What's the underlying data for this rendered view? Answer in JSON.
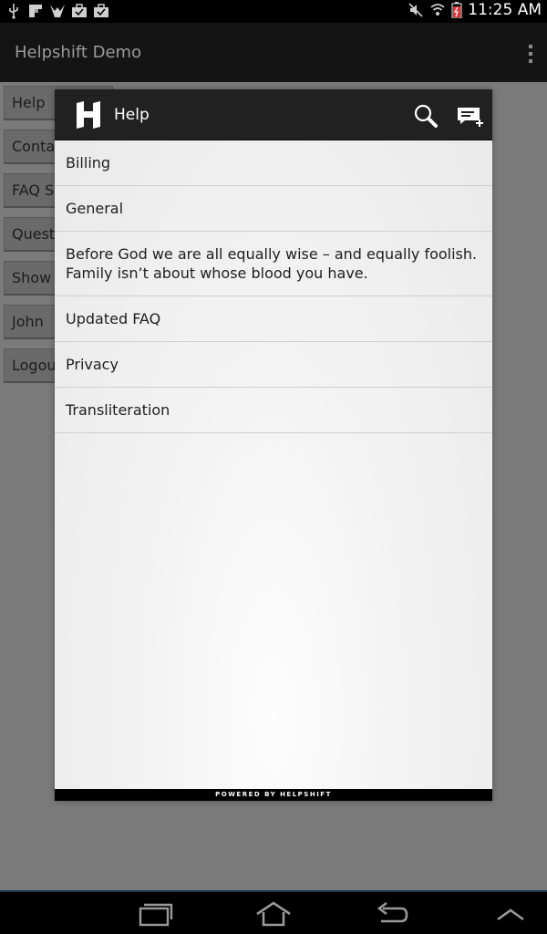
{
  "status_bar": {
    "time": "11:25 AM",
    "left_icons": [
      "usb-icon",
      "flipboard-icon",
      "debug-icon",
      "briefcase-icon",
      "briefcase-check-icon"
    ],
    "right_icons": [
      "mute-icon",
      "wifi-icon",
      "battery-icon"
    ]
  },
  "app_bar": {
    "title": "Helpshift Demo"
  },
  "background_buttons": [
    {
      "label": "Help"
    },
    {
      "label": "Contact Us"
    },
    {
      "label": "FAQ Section"
    },
    {
      "label": "Question"
    },
    {
      "label": "Show"
    },
    {
      "label": "John"
    },
    {
      "label": "Logout"
    }
  ],
  "dialog": {
    "title": "Help",
    "logo_icon": "helpshift-logo-icon",
    "search_icon": "search-icon",
    "compose_icon": "new-conversation-icon",
    "faq_sections": [
      {
        "label": "Billing"
      },
      {
        "label": "General"
      },
      {
        "label": "Before God we are all equally wise – and equally foolish. Family isn’t about whose blood you have."
      },
      {
        "label": "Updated FAQ"
      },
      {
        "label": "Privacy"
      },
      {
        "label": "Transliteration"
      }
    ],
    "footer": "POWERED BY HELPSHIFT"
  },
  "nav_bar": {
    "buttons": [
      "recent-apps-icon",
      "home-icon",
      "back-icon",
      "menu-up-icon"
    ]
  },
  "colors": {
    "dialog_header": "#212121",
    "scrim": "#7a7a7a",
    "nav_accent": "#1e3a4a"
  }
}
